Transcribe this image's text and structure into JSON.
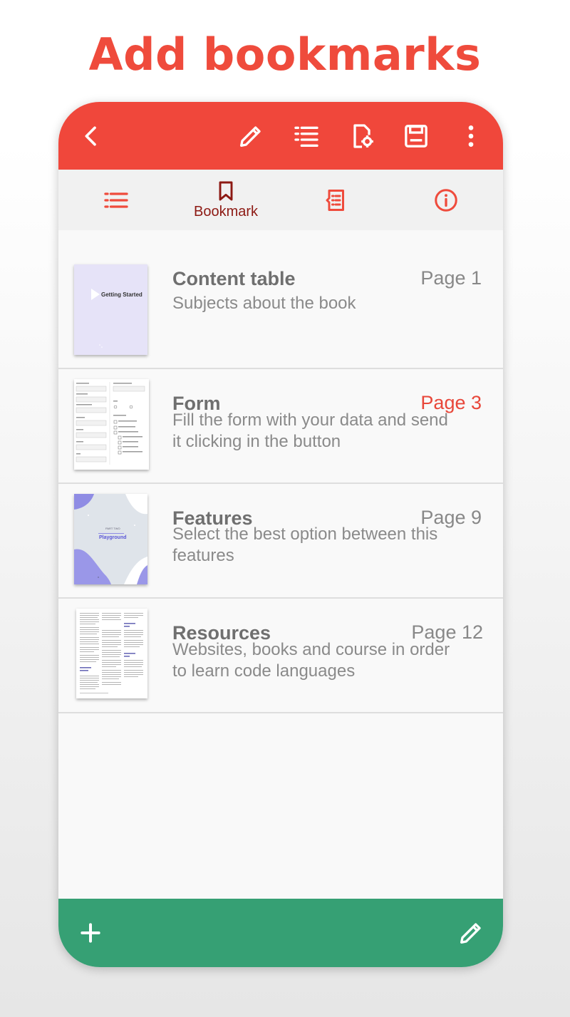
{
  "headline": "Add bookmarks",
  "colors": {
    "toolbar": "#f0473b",
    "tabbar": "#f1f1f1",
    "bottombar": "#36a074",
    "active_tab": "#8d1a14",
    "active_page": "#e8473a"
  },
  "toolbar": {
    "icons": [
      "back-icon",
      "pencil-icon",
      "list-icon",
      "document-settings-icon",
      "save-icon",
      "more-vert-icon"
    ]
  },
  "tabs": [
    {
      "icon": "list-icon",
      "label": ""
    },
    {
      "icon": "bookmark-icon",
      "label": "Bookmark"
    },
    {
      "icon": "notes-icon",
      "label": ""
    },
    {
      "icon": "info-icon",
      "label": ""
    }
  ],
  "bookmarks": [
    {
      "title": "Content table",
      "page": "Page 1",
      "desc": "Subjects about the book",
      "thumb_text": "Getting Started"
    },
    {
      "title": "Form",
      "page": "Page 3",
      "desc": "Fill the form with your data and send it clicking in the button"
    },
    {
      "title": "Features",
      "page": "Page 9",
      "desc": "Select the best option between this features",
      "thumb_text": "Playground",
      "thumb_subtext": "PART TWO"
    },
    {
      "title": "Resources",
      "page": "Page 12",
      "desc": "Websites, books and course in order to learn code languages"
    }
  ],
  "bottombar": {
    "icons": [
      "add-icon",
      "pencil-icon"
    ]
  }
}
